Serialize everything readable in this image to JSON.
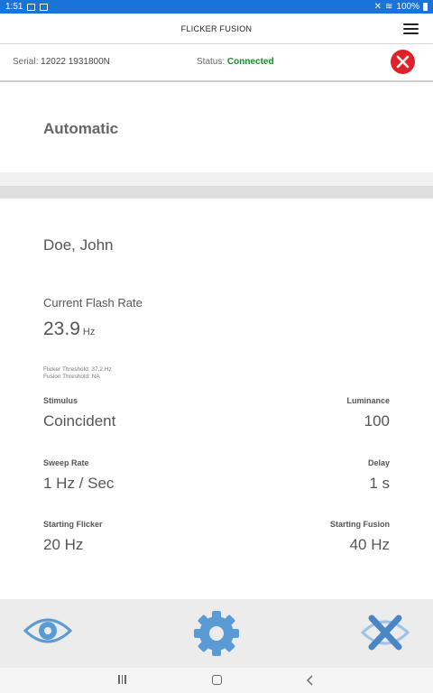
{
  "status_bar": {
    "time": "1:51",
    "battery": "100%"
  },
  "app": {
    "title": "FLICKER FUSION"
  },
  "device": {
    "serial_label": "Serial:",
    "serial_value": "12022 1931800N",
    "status_label": "Status:",
    "status_value": "Connected",
    "status_color": "#1a8c2a"
  },
  "mode": {
    "label": "Automatic"
  },
  "patient": {
    "name": "Doe, John"
  },
  "flash": {
    "label": "Current Flash Rate",
    "value": "23.9",
    "unit": "Hz",
    "flicker_threshold": "Flicker Threshold: 37.2 Hz",
    "fusion_threshold": "Fusion Threshold: NA"
  },
  "fields": {
    "stimulus": {
      "label": "Stimulus",
      "value": "Coincident"
    },
    "luminance": {
      "label": "Luminance",
      "value": "100"
    },
    "sweep_rate": {
      "label": "Sweep Rate",
      "value": "1 Hz / Sec"
    },
    "delay": {
      "label": "Delay",
      "value": "1 s"
    },
    "starting_flicker": {
      "label": "Starting Flicker",
      "value": "20 Hz"
    },
    "starting_fusion": {
      "label": "Starting Fusion",
      "value": "40 Hz"
    }
  },
  "icons": {
    "accent": "#5b9bd5",
    "close": "#e0212a",
    "statusbar": "#1a73d9"
  }
}
